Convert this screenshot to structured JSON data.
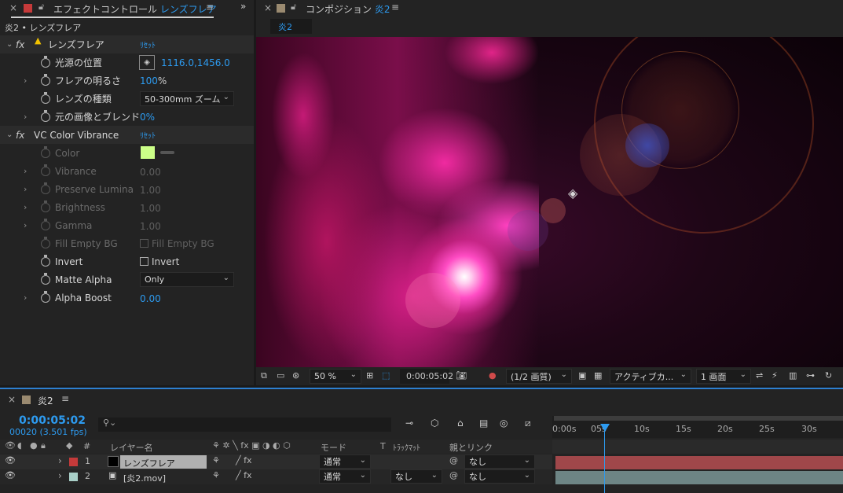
{
  "effects_panel": {
    "tab_title": "エフェクトコントロール",
    "tab_layer": "レンズフレア",
    "breadcrumb": "炎2 • レンズフレア"
  },
  "lens_flare": {
    "name": "レンズフレア",
    "reset": "ﾘｾｯﾄ",
    "props": [
      {
        "label": "光源の位置",
        "value": "1116.0,1456.0"
      },
      {
        "label": "フレアの明るさ",
        "value": "100",
        "unit": "%"
      },
      {
        "label": "レンズの種類",
        "value": "50-300mm ズーム"
      },
      {
        "label": "元の画像とブレンド",
        "value": "0%"
      }
    ]
  },
  "vc": {
    "name": "VC Color Vibrance",
    "reset": "ﾘｾｯﾄ",
    "color_swatch": "#ccff88",
    "props": [
      {
        "label": "Color",
        "value": ""
      },
      {
        "label": "Vibrance",
        "value": "0.00"
      },
      {
        "label": "Preserve Luminanc",
        "value": "1.00"
      },
      {
        "label": "Brightness",
        "value": "1.00"
      },
      {
        "label": "Gamma",
        "value": "1.00"
      },
      {
        "label": "Fill Empty BG",
        "value": "Fill Empty BG"
      },
      {
        "label": "Invert",
        "value": "Invert"
      },
      {
        "label": "Matte Alpha",
        "value": "Only"
      },
      {
        "label": "Alpha Boost",
        "value": "0.00"
      }
    ]
  },
  "comp": {
    "tab_title": "コンポジション",
    "tab_name": "炎2",
    "subtab": "炎2",
    "zoom": "50 %",
    "time": "0:00:05:02",
    "resolution": "(1/2 画質)",
    "camera": "アクティブカ...",
    "views": "1 画面"
  },
  "timeline": {
    "tab_name": "炎2",
    "time": "0:00:05:02",
    "frames": "00020 (3.501 fps)",
    "search_placeholder": "",
    "headers": {
      "num": "#",
      "layer_name": "レイヤー名",
      "mode": "モード",
      "t": "T",
      "trkmat": "ﾄﾗｯｸﾏｯﾄ",
      "parent": "親とリンク"
    },
    "ruler": [
      "0:00s",
      "05s",
      "10s",
      "15s",
      "20s",
      "25s",
      "30s"
    ],
    "layers": [
      {
        "num": "1",
        "name": "レンズフレア",
        "mode": "通常",
        "trkmat": "",
        "parent": "なし",
        "label_color": "#c43a3a",
        "bar_color": "#a0474a"
      },
      {
        "num": "2",
        "name": "[炎2.mov]",
        "mode": "通常",
        "trkmat": "なし",
        "parent": "なし",
        "label_color": "#a9cfc8",
        "bar_color": "#6d8585"
      }
    ]
  },
  "icons": [
    "close-icon",
    "lock-icon",
    "menu-icon",
    "stopwatch-icon",
    "fx-icon",
    "warning-icon",
    "crosshair-icon",
    "eye-icon",
    "search-icon"
  ]
}
